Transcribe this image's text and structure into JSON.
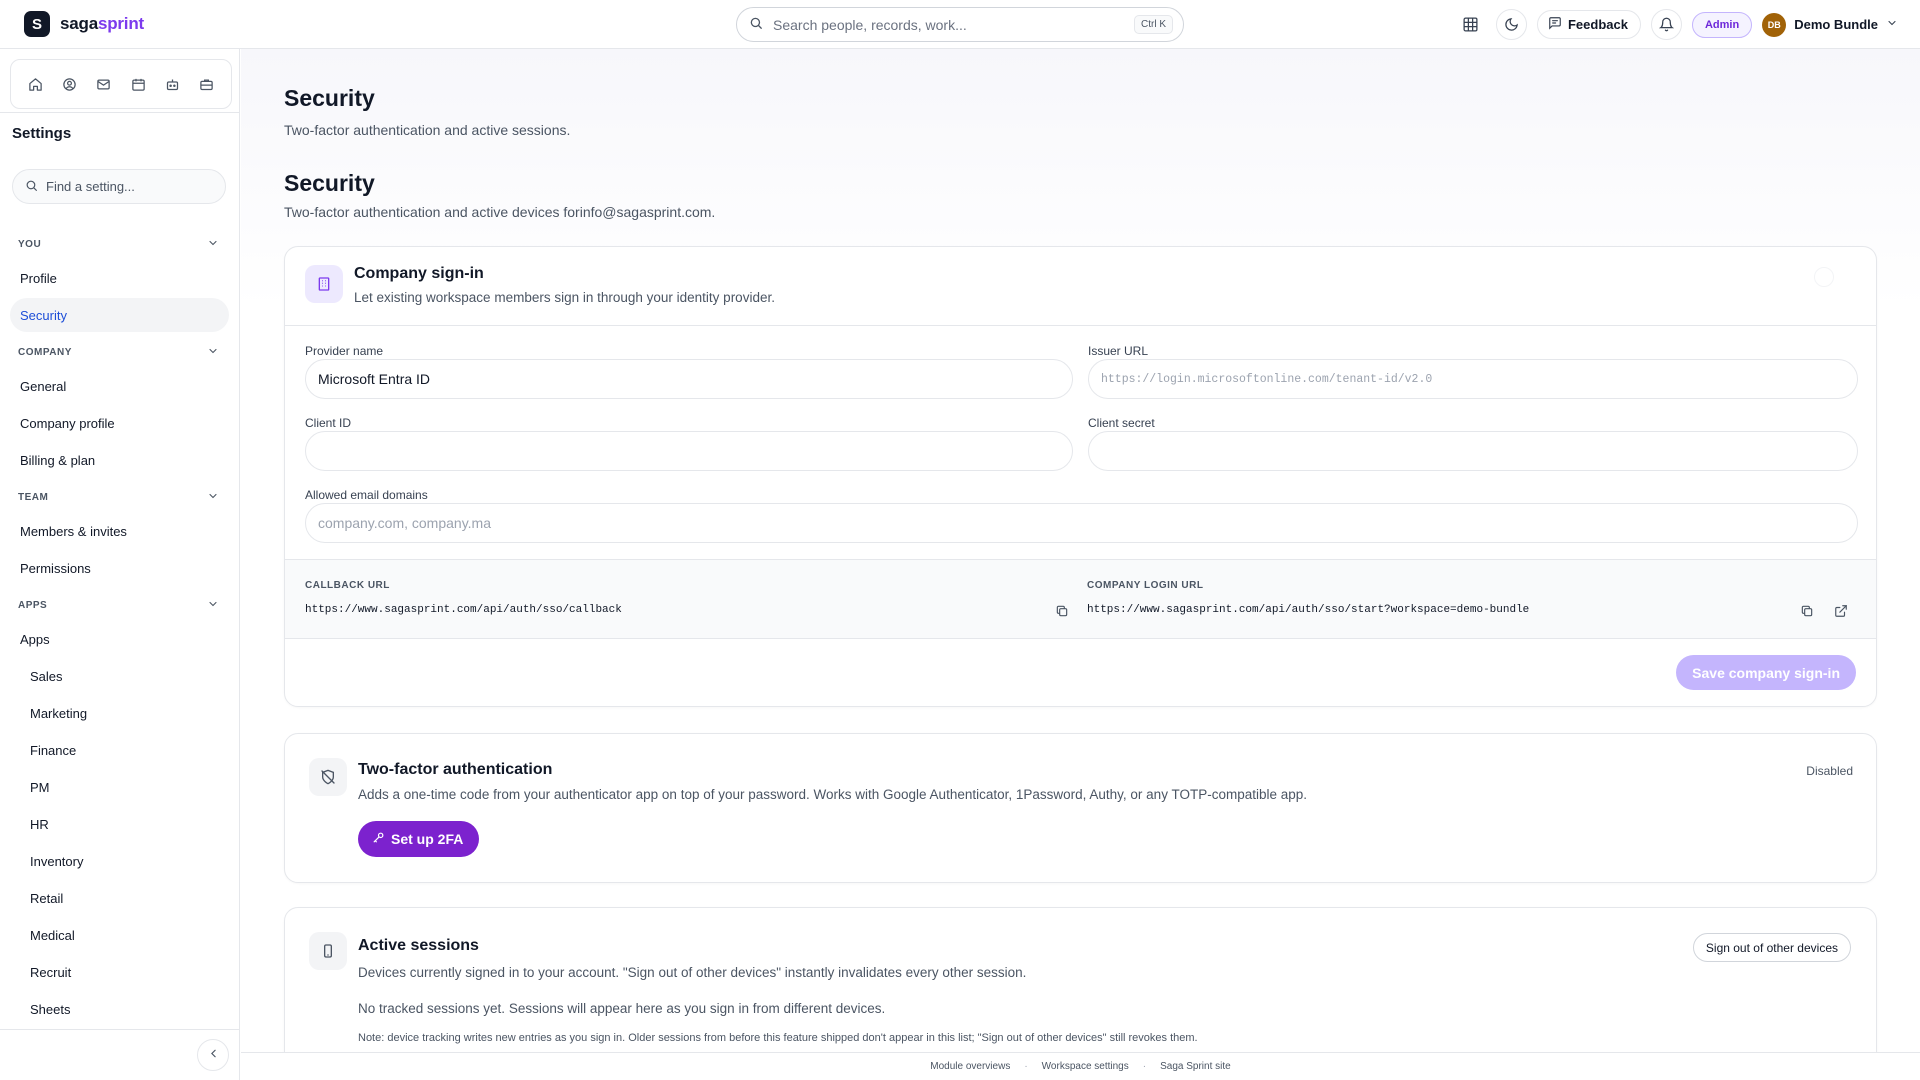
{
  "brand": {
    "logo_letter": "S",
    "name_part1": "saga",
    "name_part2": "sprint",
    "accent": "#7c3aed"
  },
  "topbar": {
    "search_placeholder": "Search people, records, work...",
    "search_shortcut": "Ctrl K",
    "feedback_label": "Feedback",
    "admin_badge": "Admin",
    "user_initials": "DB",
    "user_name": "Demo Bundle"
  },
  "sidebar": {
    "module_icons": [
      "home-icon",
      "user-circle-icon",
      "mail-icon",
      "calendar-icon",
      "robot-icon",
      "briefcase-icon"
    ],
    "title": "Settings",
    "search_placeholder": "Find a setting...",
    "sections": [
      {
        "label": "YOU",
        "items": [
          {
            "label": "Profile"
          },
          {
            "label": "Security"
          }
        ]
      },
      {
        "label": "COMPANY",
        "items": [
          {
            "label": "General"
          },
          {
            "label": "Company profile"
          },
          {
            "label": "Billing & plan"
          }
        ]
      },
      {
        "label": "TEAM",
        "items": [
          {
            "label": "Members & invites"
          },
          {
            "label": "Permissions"
          }
        ]
      },
      {
        "label": "APPS",
        "items": [
          {
            "label": "Apps"
          },
          {
            "label": "Sales"
          },
          {
            "label": "Marketing"
          },
          {
            "label": "Finance"
          },
          {
            "label": "PM"
          },
          {
            "label": "HR"
          },
          {
            "label": "Inventory"
          },
          {
            "label": "Retail"
          },
          {
            "label": "Medical"
          },
          {
            "label": "Recruit"
          },
          {
            "label": "Sheets"
          }
        ]
      }
    ]
  },
  "page": {
    "title": "Security",
    "subtitle": "Two-factor authentication and active sessions.",
    "section_title": "Security",
    "section_subtitle": "Two-factor authentication and active devices forinfo@sagasprint.com."
  },
  "company_signin": {
    "title": "Company sign-in",
    "description": "Let existing workspace members sign in through your identity provider.",
    "provider_label": "Provider name",
    "provider_value": "Microsoft Entra ID",
    "issuer_label": "Issuer URL",
    "issuer_placeholder": "https://login.microsoftonline.com/tenant-id/v2.0",
    "client_id_label": "Client ID",
    "client_secret_label": "Client secret",
    "domains_label": "Allowed email domains",
    "domains_placeholder": "company.com, company.ma",
    "callback_label": "CALLBACK URL",
    "callback_value": "https://www.sagasprint.com/api/auth/sso/callback",
    "login_label": "COMPANY LOGIN URL",
    "login_value": "https://www.sagasprint.com/api/auth/sso/start?workspace=demo-bundle",
    "save_label": "Save company sign-in"
  },
  "two_factor": {
    "title": "Two-factor authentication",
    "description": "Adds a one-time code from your authenticator app on top of your password. Works with Google Authenticator, 1Password, Authy, or any TOTP-compatible app.",
    "status": "Disabled",
    "setup_label": "Set up 2FA"
  },
  "sessions": {
    "title": "Active sessions",
    "description": "Devices currently signed in to your account. \"Sign out of other devices\" instantly invalidates every other session.",
    "signout_label": "Sign out of other devices",
    "empty_text": "No tracked sessions yet. Sessions will appear here as you sign in from different devices.",
    "note": "Note: device tracking writes new entries as you sign in. Older sessions from before this feature shipped don't appear in this list; \"Sign out of other devices\" still revokes them."
  },
  "footer": {
    "links": [
      "Module overviews",
      "Workspace settings",
      "Saga Sprint site"
    ]
  }
}
